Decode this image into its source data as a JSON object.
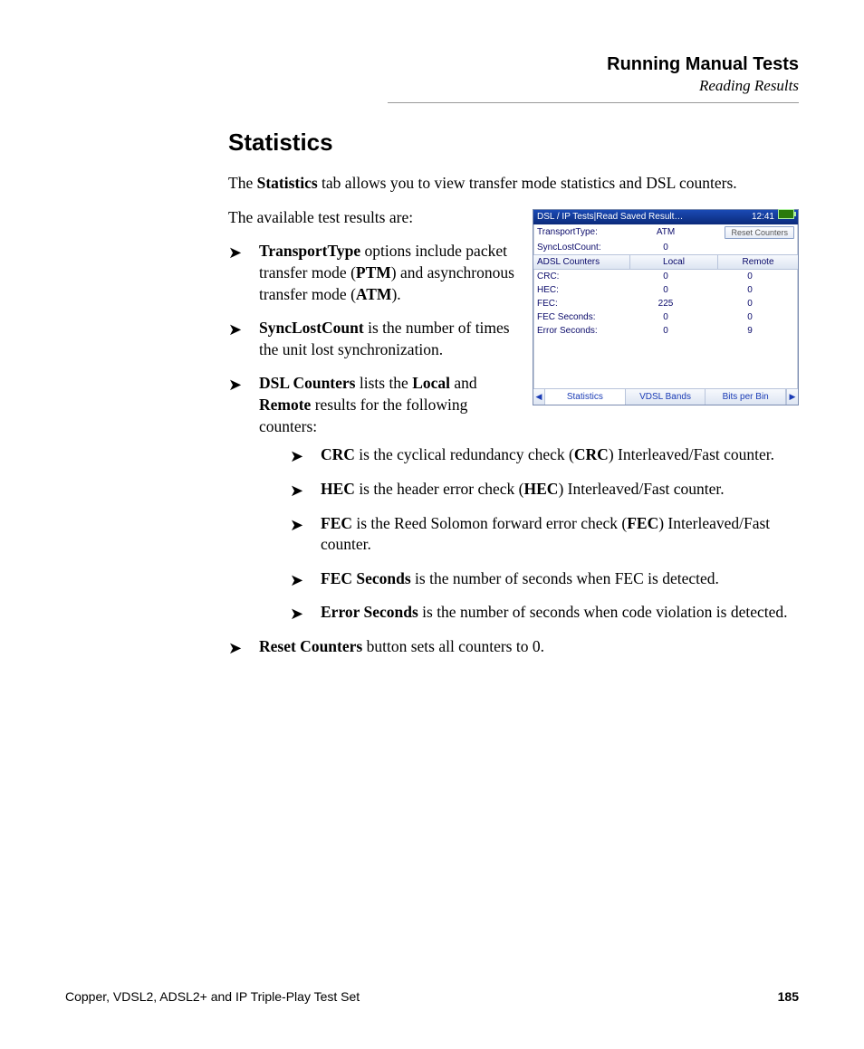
{
  "header": {
    "title": "Running Manual Tests",
    "subtitle": "Reading Results"
  },
  "section_title": "Statistics",
  "intro_pre": "The ",
  "intro_bold": "Statistics",
  "intro_post": " tab allows you to view transfer mode statistics and DSL counters.",
  "avail": "The available test results are:",
  "b1": {
    "a": "TransportType",
    "b": " options include packet transfer mode (",
    "c": "PTM",
    "d": ") and asynchronous transfer mode (",
    "e": "ATM",
    "f": ")."
  },
  "b2": {
    "a": "SyncLostCount",
    "b": " is the number of times the unit lost synchronization."
  },
  "b3": {
    "a": "DSL Counters",
    "b": " lists the ",
    "c": "Local",
    "d": " and ",
    "e": "Remote",
    "f": " results for the following counters:"
  },
  "s1": {
    "a": "CRC",
    "b": " is the cyclical redundancy check (",
    "c": "CRC",
    "d": ") Interleaved/Fast counter."
  },
  "s2": {
    "a": "HEC",
    "b": " is the header error check (",
    "c": "HEC",
    "d": ") Interleaved/Fast counter."
  },
  "s3": {
    "a": "FEC",
    "b": " is the Reed Solomon forward error check (",
    "c": "FEC",
    "d": ") Interleaved/Fast counter."
  },
  "s4": {
    "a": "FEC Seconds",
    "b": " is the number of seconds when FEC is detected."
  },
  "s5": {
    "a": "Error Seconds",
    "b": " is the number of seconds when code violation is detected."
  },
  "b4": {
    "a": "Reset Counters",
    "b": " button sets all counters to 0."
  },
  "scr": {
    "title": "DSL / IP Tests|Read Saved Result…",
    "time": "12:41",
    "reset_btn": "Reset Counters",
    "transport_lbl": "TransportType:",
    "transport_val": "ATM",
    "sync_lbl": "SyncLostCount:",
    "sync_val": "0",
    "hdr_a": "ADSL Counters",
    "hdr_b": "Local",
    "hdr_c": "Remote",
    "rows": [
      {
        "lbl": "CRC:",
        "v1": "0",
        "v2": "0"
      },
      {
        "lbl": "HEC:",
        "v1": "0",
        "v2": "0"
      },
      {
        "lbl": "FEC:",
        "v1": "225",
        "v2": "0"
      },
      {
        "lbl": "FEC Seconds:",
        "v1": "0",
        "v2": "0"
      },
      {
        "lbl": "Error Seconds:",
        "v1": "0",
        "v2": "9"
      }
    ],
    "tabs": {
      "t1": "Statistics",
      "t2": "VDSL Bands",
      "t3": "Bits per Bin"
    }
  },
  "footer": {
    "left": "Copper, VDSL2, ADSL2+ and IP Triple-Play Test Set",
    "page": "185"
  }
}
